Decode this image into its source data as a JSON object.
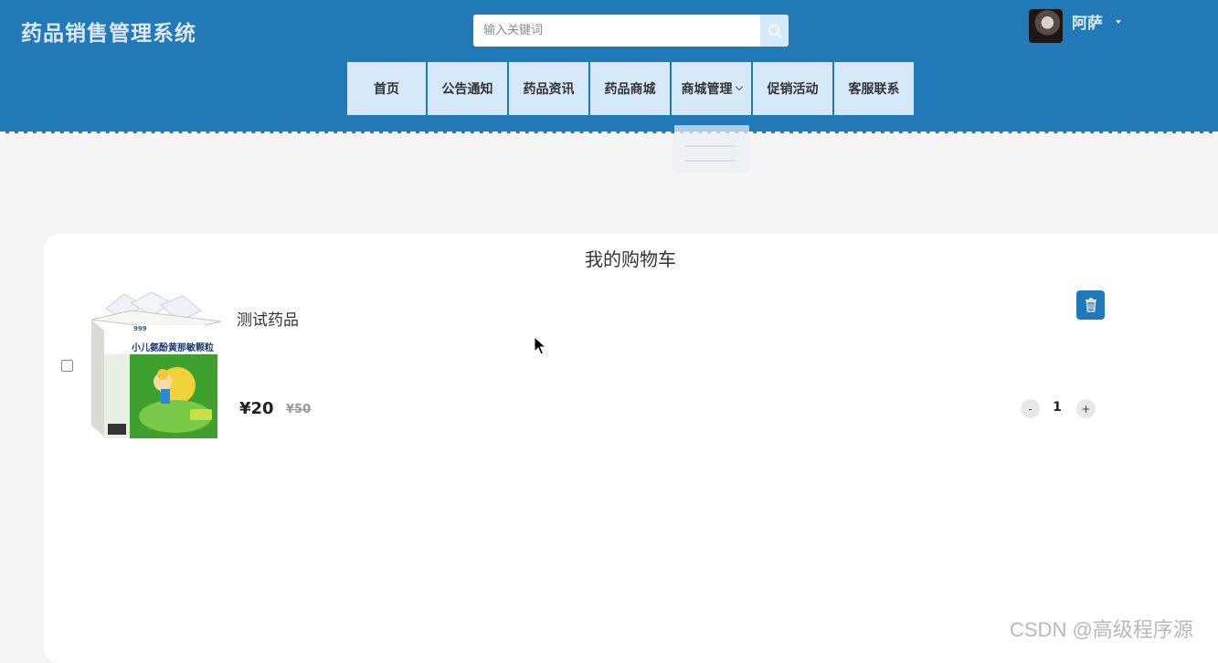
{
  "header": {
    "logo": "药品销售管理系统",
    "search_placeholder": "输入关键词",
    "search_icon": "search-icon",
    "username": "阿萨",
    "colors": {
      "primary": "#2179b8",
      "nav_bg": "#d6e9f8",
      "logo_text": "#dbe8f4"
    }
  },
  "nav": {
    "items": [
      {
        "label": "首页"
      },
      {
        "label": "公告通知"
      },
      {
        "label": "药品资讯"
      },
      {
        "label": "药品商城"
      },
      {
        "label": "商城管理",
        "has_dropdown": true
      },
      {
        "label": "促销活动"
      },
      {
        "label": "客服联系"
      }
    ]
  },
  "cart": {
    "title": "我的购物车",
    "items": [
      {
        "name": "测试药品",
        "price": "¥20",
        "original_price": "¥50",
        "quantity": "1",
        "minus": "-",
        "plus": "+",
        "image_text": "小儿氨酚黄那敏颗粒",
        "image_brand": "999"
      }
    ]
  },
  "watermark": "CSDN @高级程序源"
}
